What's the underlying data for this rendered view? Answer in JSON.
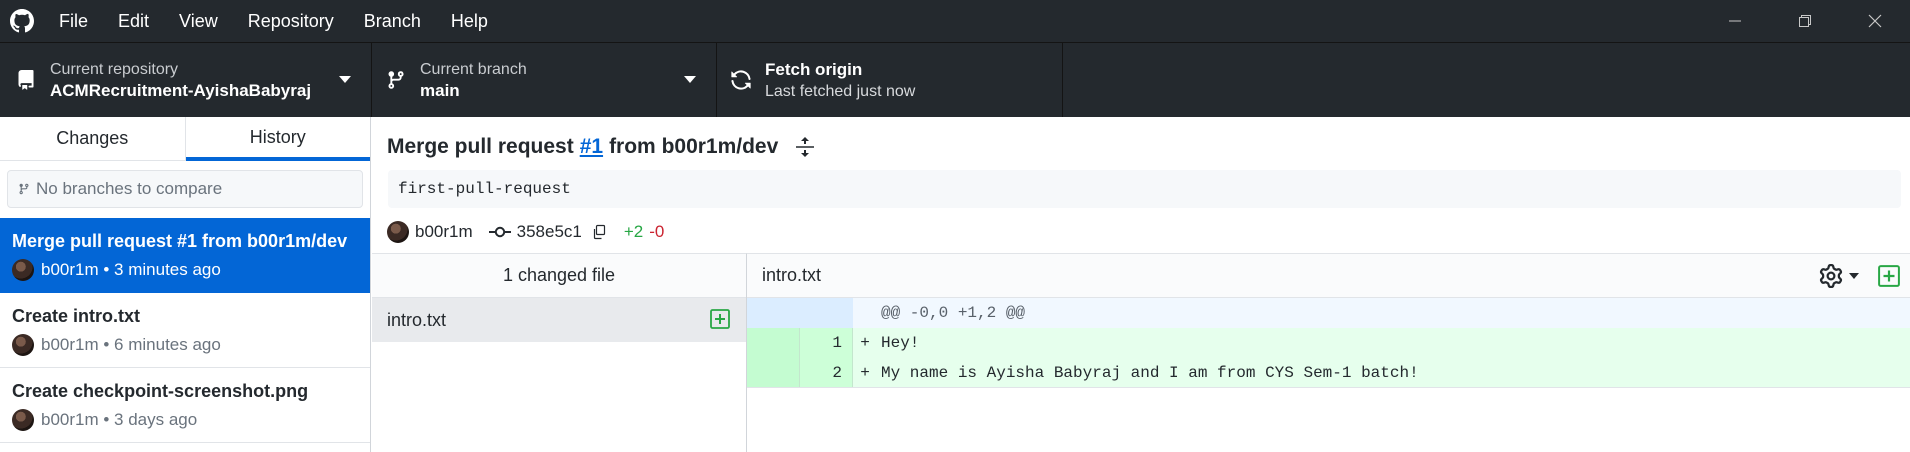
{
  "menu": [
    "File",
    "Edit",
    "View",
    "Repository",
    "Branch",
    "Help"
  ],
  "toolbar": {
    "repo_label": "Current repository",
    "repo_value": "ACMRecruitment-AyishaBabyraj",
    "branch_label": "Current branch",
    "branch_value": "main",
    "fetch_title": "Fetch origin",
    "fetch_status": "Last fetched just now"
  },
  "sidebar": {
    "tabs": [
      "Changes",
      "History"
    ],
    "compare_placeholder": "No branches to compare",
    "commits": [
      {
        "title": "Merge pull request #1 from b00r1m/dev",
        "meta": "b00r1m • 3 minutes ago"
      },
      {
        "title": "Create intro.txt",
        "meta": "b00r1m • 6 minutes ago"
      },
      {
        "title": "Create checkpoint-screenshot.png",
        "meta": "b00r1m • 3 days ago"
      }
    ]
  },
  "commit": {
    "title_prefix": "Merge pull request",
    "pr_link": "#1",
    "title_suffix": "from b00r1m/dev",
    "description": "first-pull-request",
    "author": "b00r1m",
    "sha": "358e5c1",
    "additions": "+2",
    "deletions": "-0"
  },
  "files": {
    "header": "1 changed file",
    "items": [
      {
        "name": "intro.txt",
        "status": "added"
      }
    ]
  },
  "diff": {
    "filename": "intro.txt",
    "hunk": "@@ -0,0 +1,2 @@",
    "lines": [
      {
        "num": "1",
        "sign": "+",
        "text": "Hey!"
      },
      {
        "num": "2",
        "sign": "+",
        "text": "My name is Ayisha Babyraj and I am from CYS Sem-1 batch!"
      }
    ]
  },
  "colors": {
    "accent": "#0366d6",
    "added": "#28a745",
    "deleted": "#cb2431",
    "chrome": "#24292e"
  }
}
